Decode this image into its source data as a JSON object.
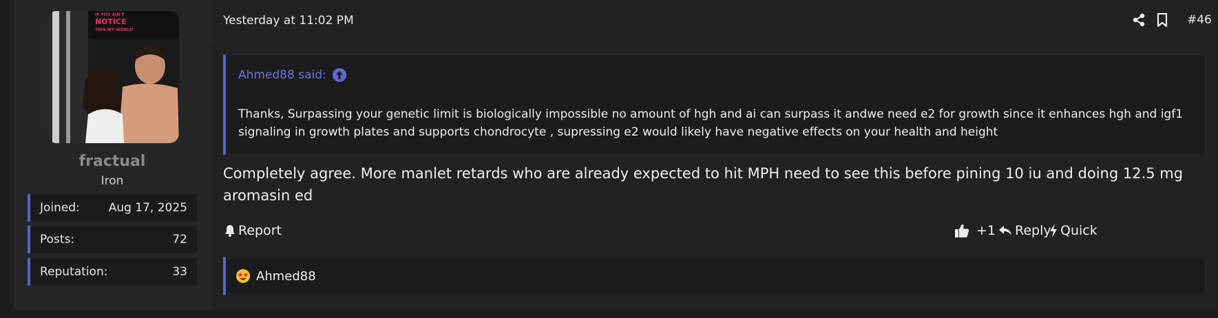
{
  "user": {
    "name": "fractual",
    "title": "Iron",
    "avatar_text": "IF YOU AIN'T NOTICE THIS MY WORLD",
    "stats": [
      {
        "label": "Joined:",
        "value": "Aug 17, 2025"
      },
      {
        "label": "Posts:",
        "value": "72"
      },
      {
        "label": "Reputation:",
        "value": "33"
      }
    ]
  },
  "post": {
    "date": "Yesterday at 11:02 PM",
    "number": "#46",
    "quote": {
      "author": "Ahmed88 said:",
      "text": "Thanks, Surpassing your genetic limit is biologically impossible no amount of hgh and ai can surpass it andwe need e2 for growth since it enhances hgh and igf1 signaling in growth plates and supports chondrocyte , supressing e2 would likely have negative effects on your health and height"
    },
    "message": "Completely agree. More manlet retards who are already expected to hit MPH need to see this before pining 10 iu and doing 12.5 mg aromasin ed",
    "actions": {
      "report": "Report",
      "like": "+1",
      "reply": "Reply",
      "quick": "Quick"
    },
    "reactions": {
      "user": "Ahmed88",
      "emoji": "star-struck"
    }
  },
  "colors": {
    "accent": "#5a64c6",
    "quote_author": "#6b76d6",
    "background": "#222224"
  }
}
